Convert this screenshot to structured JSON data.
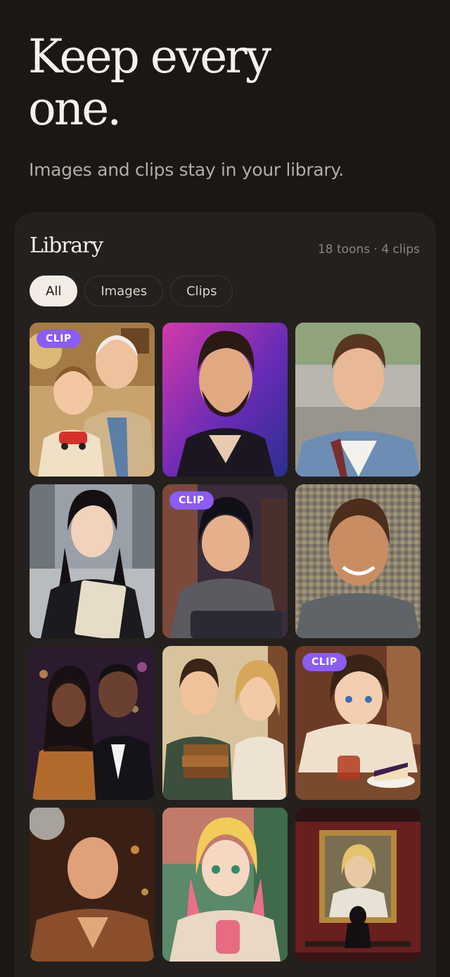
{
  "hero": {
    "headline_line1": "Keep every",
    "headline_line2": "one.",
    "subhead": "Images and clips stay in your library."
  },
  "library": {
    "title": "Library",
    "count": "18 toons · 4 clips",
    "filters": [
      {
        "label": "All",
        "active": true
      },
      {
        "label": "Images",
        "active": false
      },
      {
        "label": "Clips",
        "active": false
      }
    ],
    "clip_badge": "CLIP",
    "items": [
      {
        "kind": "clip",
        "subject": "grandfather with toddler"
      },
      {
        "kind": "image",
        "subject": "bearded man neon portrait"
      },
      {
        "kind": "image",
        "subject": "young man denim jacket"
      },
      {
        "kind": "image",
        "subject": "woman holding folders in city"
      },
      {
        "kind": "clip",
        "subject": "anime boy with laptop"
      },
      {
        "kind": "image",
        "subject": "mosaic portrait man"
      },
      {
        "kind": "image",
        "subject": "couple in evening wear"
      },
      {
        "kind": "image",
        "subject": "couple with books"
      },
      {
        "kind": "clip",
        "subject": "toon boy with tea and cake"
      },
      {
        "kind": "image",
        "subject": "disco man portrait"
      },
      {
        "kind": "image",
        "subject": "anime girl with drink"
      },
      {
        "kind": "image",
        "subject": "gallery painting viewer"
      }
    ]
  },
  "colors": {
    "background": "#1a1715",
    "card": "#24201d",
    "badge": "#8b5cf6",
    "chip_active": "#f2ece4"
  }
}
